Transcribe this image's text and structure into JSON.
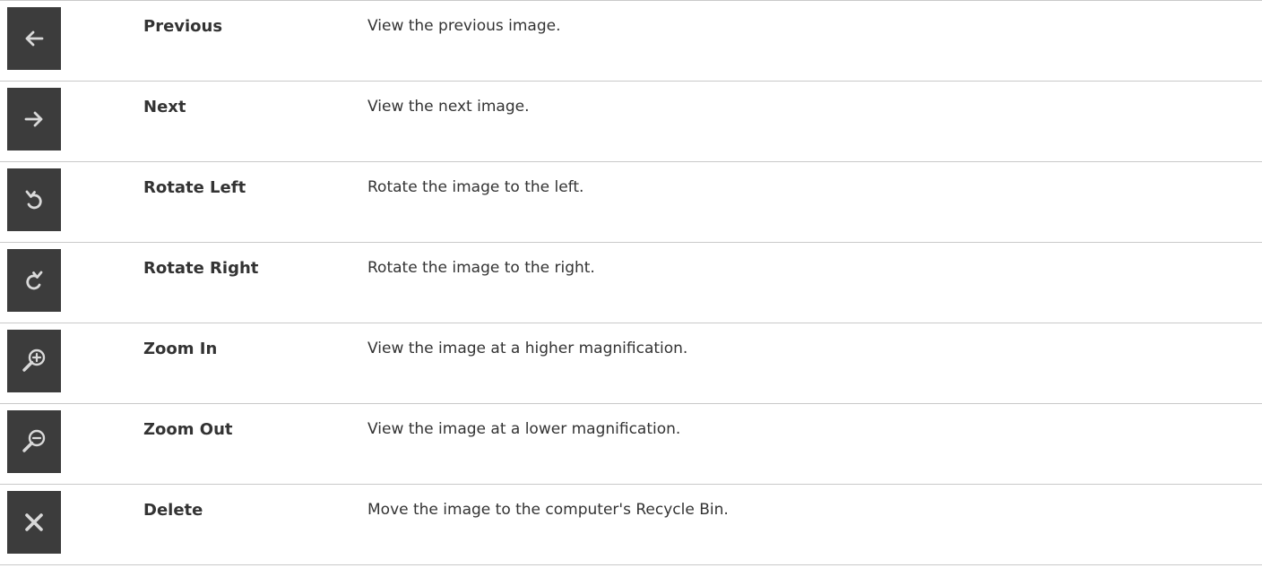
{
  "rows": [
    {
      "icon": "arrow-left-icon",
      "name": "Previous",
      "description": "View the previous image."
    },
    {
      "icon": "arrow-right-icon",
      "name": "Next",
      "description": "View the next image."
    },
    {
      "icon": "rotate-left-icon",
      "name": "Rotate Left",
      "description": "Rotate the image to the left."
    },
    {
      "icon": "rotate-right-icon",
      "name": "Rotate Right",
      "description": "Rotate the image to the right."
    },
    {
      "icon": "zoom-in-icon",
      "name": "Zoom In",
      "description": "View the image at a higher magnification."
    },
    {
      "icon": "zoom-out-icon",
      "name": "Zoom Out",
      "description": "View the image at a lower magnification."
    },
    {
      "icon": "delete-x-icon",
      "name": "Delete",
      "description": "Move the image to the computer's Recycle Bin."
    }
  ],
  "colors": {
    "icon_background": "#3c3c3c",
    "icon_glyph": "#d9d9d9",
    "divider": "#c9c9c9",
    "text": "#333333"
  }
}
